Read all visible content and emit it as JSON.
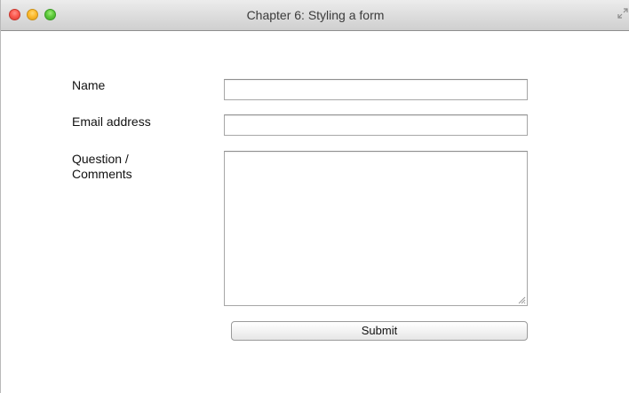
{
  "window": {
    "title": "Chapter 6: Styling a form"
  },
  "form": {
    "name_label": "Name",
    "name_value": "",
    "email_label": "Email address",
    "email_value": "",
    "comments_label_line1": "Question /",
    "comments_label_line2": "Comments",
    "comments_value": "",
    "submit_label": "Submit"
  },
  "icons": {
    "close": "close-icon",
    "minimize": "minimize-icon",
    "maximize": "maximize-icon",
    "fullscreen": "fullscreen-icon",
    "resize": "resize-grip-icon"
  },
  "colors": {
    "close": "#fc5b51",
    "minimize": "#fdbb2f",
    "maximize": "#5fcb3c"
  }
}
